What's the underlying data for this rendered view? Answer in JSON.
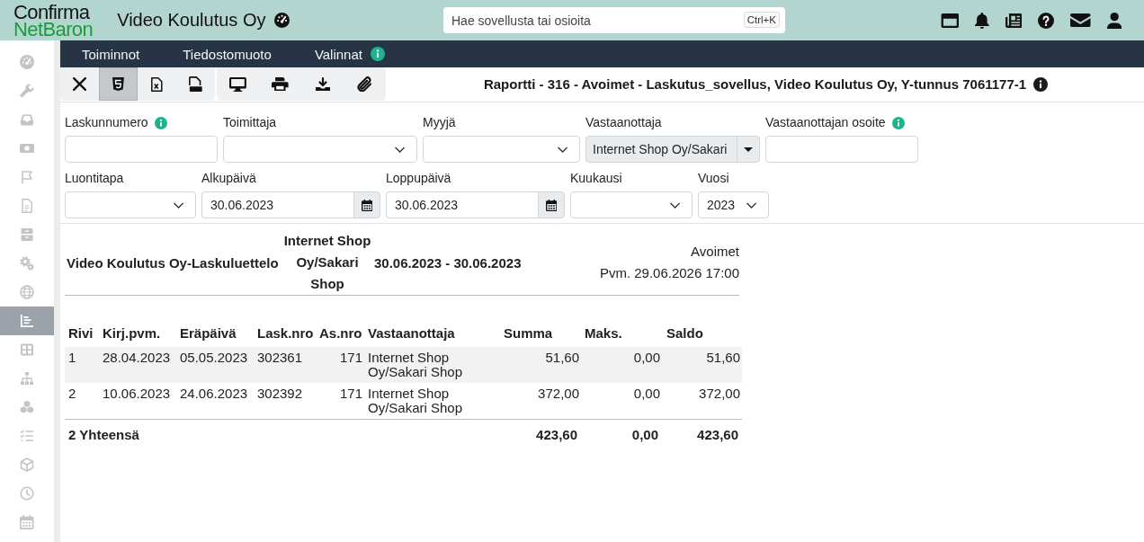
{
  "header": {
    "logo": {
      "line_1": "Confirma",
      "line_2": "NetBaron"
    },
    "company": "Video Koulutus Oy",
    "search": {
      "placeholder": "Hae sovellusta tai osioita",
      "shortcut": "Ctrl+K"
    }
  },
  "sidebar": {
    "items": [
      {
        "selected": false
      },
      {
        "selected": false
      },
      {
        "selected": false
      },
      {
        "selected": false
      },
      {
        "selected": false
      },
      {
        "selected": false
      },
      {
        "selected": false
      },
      {
        "selected": false
      },
      {
        "selected": false
      },
      {
        "selected": true
      },
      {
        "selected": false
      },
      {
        "selected": false
      },
      {
        "selected": false
      },
      {
        "selected": false
      },
      {
        "selected": false
      },
      {
        "selected": false
      },
      {
        "selected": false
      }
    ]
  },
  "menu": [
    {
      "label": "Toiminnot"
    },
    {
      "label": "Tiedostomuoto"
    },
    {
      "label": "Valinnat",
      "info": true
    }
  ],
  "toolbar": {
    "groups": [
      [
        {
          "selected": false
        },
        {
          "selected": true
        },
        {
          "selected": false
        },
        {
          "selected": false
        }
      ],
      [
        {
          "selected": false
        },
        {
          "selected": false
        },
        {
          "selected": false
        },
        {
          "selected": false
        }
      ]
    ],
    "title": "Raportti - 316 - Avoimet - Laskutus_sovellus, Video Koulutus Oy, Y-tunnus 7061177-1",
    "info": true
  },
  "filter_rows": [
    [
      {
        "label": "Laskunnumero",
        "kind": "text",
        "info": true
      },
      {
        "label": "Toimittaja",
        "kind": "select"
      },
      {
        "label": "Myyjä",
        "kind": "select"
      },
      {
        "label": "Vastaanottaja",
        "kind": "combo",
        "value": "Internet Shop Oy/Sakari"
      },
      {
        "label": "Vastaanottajan osoite",
        "kind": "text",
        "info": true
      }
    ],
    [
      {
        "label": "Luontitapa",
        "kind": "select"
      },
      {
        "label": "Alkupäivä",
        "kind": "date",
        "value": "30.06.2023"
      },
      {
        "label": "Loppupäivä",
        "kind": "date",
        "value": "30.06.2023"
      },
      {
        "label": "Kuukausi",
        "kind": "select"
      },
      {
        "label": "Vuosi",
        "kind": "select",
        "value": "2023"
      }
    ]
  ],
  "report": {
    "title": "Video Koulutus Oy-Laskuluettelo",
    "recipient": "Internet Shop Oy/Sakari Shop",
    "period": "30.06.2023 - 30.06.2023",
    "status": "Avoimet",
    "printed": "Pvm. 29.06.2026 17:00",
    "table": {
      "columns": [
        "Rivi",
        "Kirj.pvm.",
        "Eräpäivä",
        "Lask.nro",
        "As.nro",
        "Vastaanottaja",
        "Summa",
        "Maks.",
        "Saldo"
      ],
      "rows": [
        [
          "1",
          "28.04.2023",
          "05.05.2023",
          "302361",
          "171",
          "Internet Shop Oy/Sakari Shop",
          "51,60",
          "0,00",
          "51,60"
        ],
        [
          "2",
          "10.06.2023",
          "24.06.2023",
          "302392",
          "171",
          "Internet Shop Oy/Sakari Shop",
          "372,00",
          "0,00",
          "372,00"
        ]
      ],
      "total": {
        "label": "2 Yhteensä",
        "values": [
          "423,60",
          "0,00",
          "423,60"
        ]
      }
    }
  }
}
